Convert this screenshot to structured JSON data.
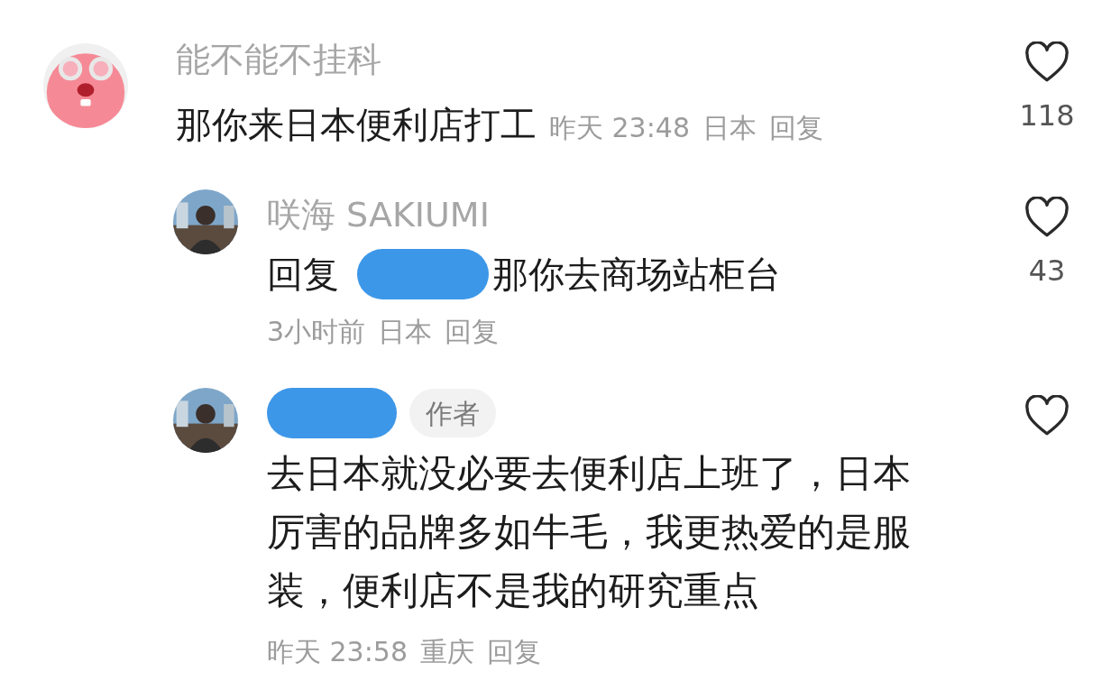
{
  "comments": [
    {
      "kind": "top",
      "author": "能不能不挂科",
      "author_hidden": false,
      "text": "那你来日本便利店打工",
      "time": "昨天 23:48",
      "location": "日本",
      "reply": "回复",
      "likes": "118"
    },
    {
      "kind": "reply",
      "author": "咲海 SAKIUMI",
      "author_hidden": false,
      "reply_prefix": "回复",
      "reply_to_hidden": true,
      "text": "那你去商场站柜台",
      "time": "3小时前",
      "location": "日本",
      "reply": "回复",
      "likes": "43"
    },
    {
      "kind": "reply",
      "author_hidden": true,
      "badge": "作者",
      "text": "去日本就没必要去便利店上班了，日本厉害的品牌多如牛毛，我更热爱的是服装，便利店不是我的研究重点",
      "time": "昨天 23:58",
      "location": "重庆",
      "reply": "回复"
    }
  ]
}
